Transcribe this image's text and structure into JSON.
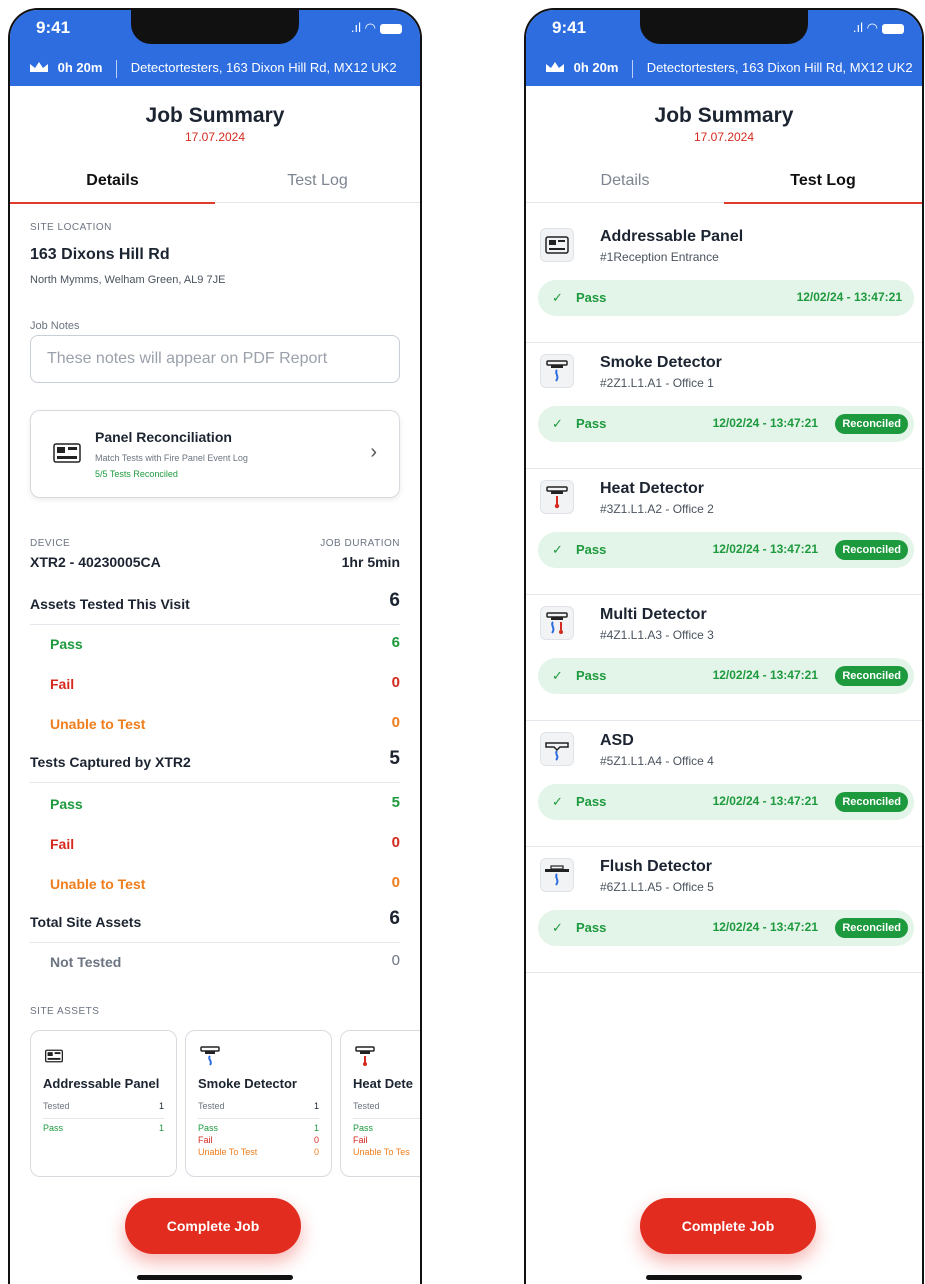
{
  "status": {
    "time": "9:41",
    "signal": ".ıl"
  },
  "banner": {
    "duration": "0h 20m",
    "address": "Detectortesters, 163 Dixon Hill Rd, MX12 UK2"
  },
  "header": {
    "title": "Job Summary",
    "date": "17.07.2024"
  },
  "tabs": {
    "details": "Details",
    "test_log": "Test Log"
  },
  "site": {
    "label": "SITE LOCATION",
    "street": "163 Dixons Hill Rd",
    "area": "North Mymms, Welham Green,  AL9 7JE"
  },
  "notes": {
    "label": "Job Notes",
    "placeholder": "These notes will appear on PDF Report"
  },
  "panel_rec": {
    "title": "Panel Reconciliation",
    "subtitle": "Match Tests with Fire Panel Event Log",
    "status": "5/5 Tests Reconciled"
  },
  "device": {
    "label": "DEVICE",
    "value": "XTR2 - 40230005CA",
    "duration_label": "JOB DURATION",
    "duration": "1hr 5min"
  },
  "stats": {
    "assets_tested": {
      "label": "Assets Tested This Visit",
      "value": "6"
    },
    "assets_pass": {
      "label": "Pass",
      "value": "6"
    },
    "assets_fail": {
      "label": "Fail",
      "value": "0"
    },
    "assets_unable": {
      "label": "Unable to Test",
      "value": "0"
    },
    "tests_captured": {
      "label": "Tests Captured by XTR2",
      "value": "5"
    },
    "tests_pass": {
      "label": "Pass",
      "value": "5"
    },
    "tests_fail": {
      "label": "Fail",
      "value": "0"
    },
    "tests_unable": {
      "label": "Unable to Test",
      "value": "0"
    },
    "total": {
      "label": "Total Site Assets",
      "value": "6"
    },
    "not_tested": {
      "label": "Not Tested",
      "value": "0"
    }
  },
  "site_assets": {
    "label": "SITE ASSETS",
    "cards": [
      {
        "name": "Addressable Panel",
        "tested": "Tested",
        "tested_n": "1",
        "pass": "Pass",
        "pass_n": "1"
      },
      {
        "name": "Smoke Detector",
        "tested": "Tested",
        "tested_n": "1",
        "pass": "Pass",
        "pass_n": "1",
        "fail": "Fail",
        "fail_n": "0",
        "unable": "Unable To Test",
        "unable_n": "0"
      },
      {
        "name": "Heat Dete",
        "tested": "Tested",
        "pass": "Pass",
        "fail": "Fail",
        "unable": "Unable To Tes"
      }
    ]
  },
  "complete_button": "Complete Job",
  "test_log": [
    {
      "name": "Addressable Panel",
      "loc": "#1Reception Entrance",
      "result": "Pass",
      "ts": "12/02/24 - 13:47:21",
      "badge": ""
    },
    {
      "name": "Smoke Detector",
      "loc": "#2Z1.L1.A1 - Office 1",
      "result": "Pass",
      "ts": "12/02/24 - 13:47:21",
      "badge": "Reconciled"
    },
    {
      "name": "Heat Detector",
      "loc": "#3Z1.L1.A2 - Office 2",
      "result": "Pass",
      "ts": "12/02/24 - 13:47:21",
      "badge": "Reconciled"
    },
    {
      "name": "Multi Detector",
      "loc": "#4Z1.L1.A3 - Office 3",
      "result": "Pass",
      "ts": "12/02/24 - 13:47:21",
      "badge": "Reconciled"
    },
    {
      "name": "ASD",
      "loc": "#5Z1.L1.A4 - Office 4",
      "result": "Pass",
      "ts": "12/02/24 - 13:47:21",
      "badge": "Reconciled"
    },
    {
      "name": "Flush Detector",
      "loc": "#6Z1.L1.A5 - Office 5",
      "result": "Pass",
      "ts": "12/02/24 - 13:47:21",
      "badge": "Reconciled"
    }
  ],
  "icons": [
    "crown-icon",
    "panel-icon",
    "smoke-detector-icon",
    "heat-detector-icon",
    "multi-detector-icon",
    "asd-icon",
    "flush-detector-icon",
    "chevron-right-icon",
    "check-icon"
  ],
  "colors": {
    "brand_blue": "#2d6de0",
    "accent_red": "#e22c1f",
    "pass_green": "#1e9a3e",
    "unable_orange": "#ef7d1c"
  }
}
